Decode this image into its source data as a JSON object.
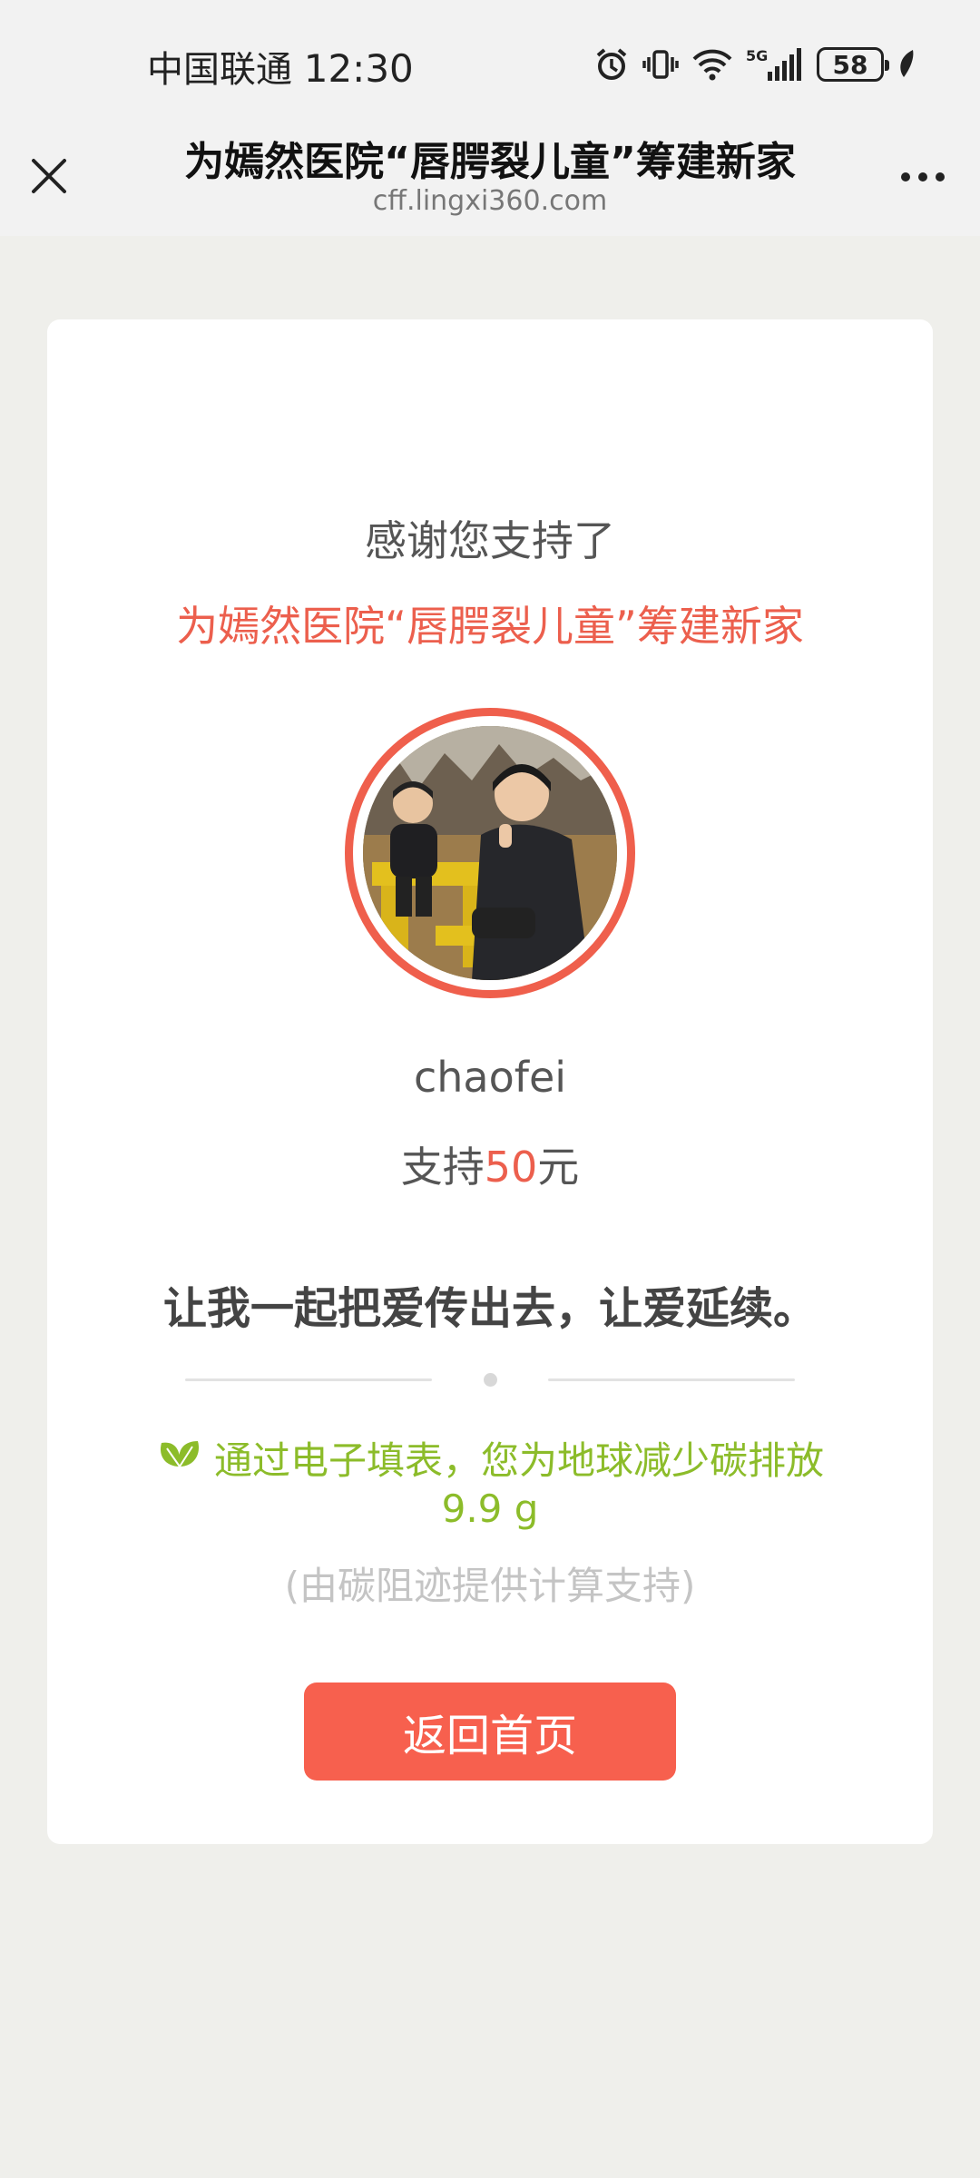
{
  "status_bar": {
    "carrier": "中国联通",
    "time": "12:30",
    "network": "5G",
    "battery": "58"
  },
  "nav": {
    "title": "为嫣然医院“唇腭裂儿童”筹建新家",
    "url": "cff.lingxi360.com",
    "close_icon": "close-icon",
    "more_icon": "more-dots-icon"
  },
  "card": {
    "thanks": "感谢您支持了",
    "project": "为嫣然医院“唇腭裂儿童”筹建新家",
    "username": "chaofei",
    "amount_prefix": "支持",
    "amount": "50",
    "amount_suffix": "元",
    "slogan": "让我一起把爱传出去，让爱延续。",
    "carbon_text": "通过电子填表，您为地球减少碳排放",
    "carbon_value": "9.9 g",
    "carbon_note": "(由碳阻迹提供计算支持)",
    "home_button": "返回首页"
  },
  "colors": {
    "accent": "#ec5f4d",
    "button": "#f7604e",
    "eco_green": "#8cbc2a",
    "background": "#efefeb"
  }
}
